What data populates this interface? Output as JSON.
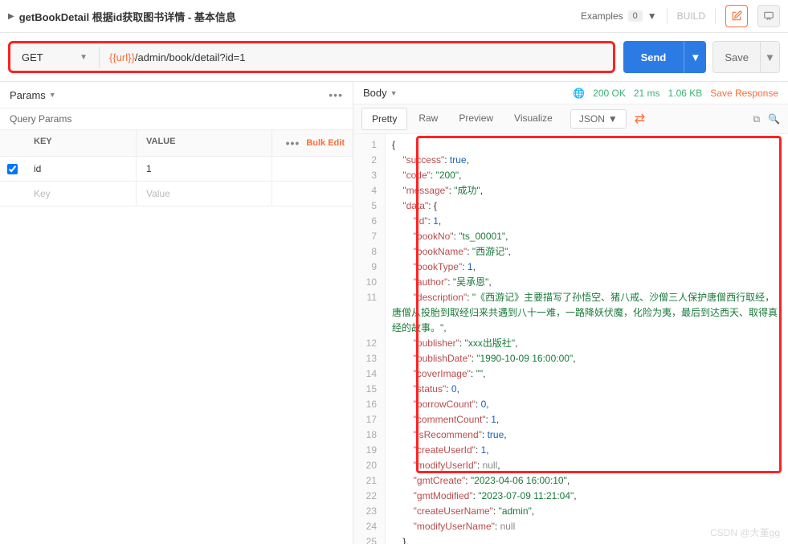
{
  "header": {
    "title": "getBookDetail 根据id获取图书详情 - 基本信息",
    "examples_label": "Examples",
    "examples_count": "0",
    "build_label": "BUILD"
  },
  "request": {
    "method": "GET",
    "url_var": "{{url}}",
    "url_path": "/admin/book/detail?id=1",
    "send_label": "Send",
    "save_label": "Save"
  },
  "left": {
    "tab": "Params",
    "subheader": "Query Params",
    "col_key": "KEY",
    "col_value": "VALUE",
    "bulk_edit": "Bulk Edit",
    "rows": [
      {
        "key": "id",
        "value": "1",
        "checked": true
      }
    ],
    "placeholder_key": "Key",
    "placeholder_value": "Value"
  },
  "right": {
    "tab": "Body",
    "status_code": "200 OK",
    "status_time": "21 ms",
    "status_size": "1.06 KB",
    "save_response": "Save Response",
    "tabs": {
      "pretty": "Pretty",
      "raw": "Raw",
      "preview": "Preview",
      "visualize": "Visualize"
    },
    "format": "JSON"
  },
  "response": {
    "success": true,
    "code": "200",
    "message": "成功",
    "data": {
      "id": 1,
      "bookNo": "ts_00001",
      "bookName": "西游记",
      "bookType": 1,
      "author": "吴承恩",
      "description": "《西游记》主要描写了孙悟空、猪八戒、沙僧三人保护唐僧西行取经，唐僧从投胎到取经归来共遇到八十一难，一路降妖伏魔，化险为夷，最后到达西天、取得真经的故事。",
      "publisher": "xxx出版社",
      "publishDate": "1990-10-09 16:00:00",
      "coverImage": "",
      "status": 0,
      "borrowCount": 0,
      "commentCount": 1,
      "isRecommend": true,
      "createUserId": 1,
      "modifyUserId": null,
      "gmtCreate": "2023-04-06 16:00:10",
      "gmtModified": "2023-07-09 11:21:04",
      "createUserName": "admin",
      "modifyUserName": null
    }
  },
  "watermark": "CSDN @大堇gg"
}
